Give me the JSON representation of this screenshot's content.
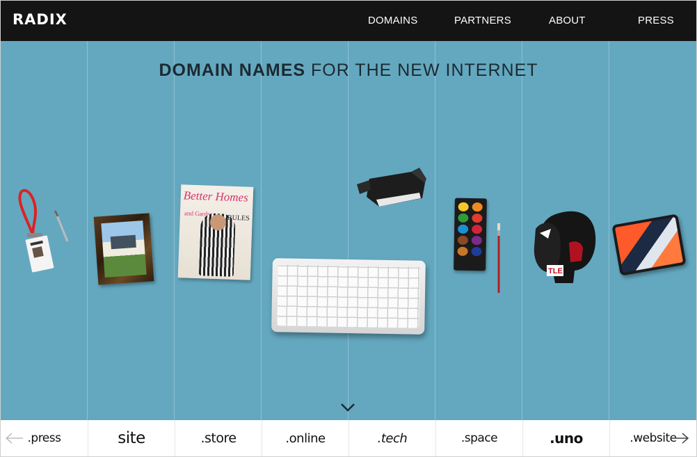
{
  "header": {
    "logo": "RADIX",
    "nav": [
      "DOMAINS",
      "PARTNERS",
      "ABOUT",
      "PRESS"
    ]
  },
  "hero": {
    "headline_bold": "DOMAIN NAMES",
    "headline_light": "FOR THE NEW INTERNET",
    "magazine_title": "Better Homes",
    "magazine_subtitle": "and Gardens",
    "magazine_cover_line": "RULES"
  },
  "tabs": [
    ".press",
    "site",
    ".store",
    ".online",
    ".tech",
    ".space",
    ".uno",
    ".website"
  ],
  "colors": {
    "header_bg": "#141414",
    "hero_bg": "#64a8c0",
    "headline_text": "#1b2a31"
  },
  "icons": {
    "left_arrow": "arrow-left-icon",
    "right_arrow": "arrow-right-icon",
    "scroll_down": "chevron-down-icon"
  }
}
